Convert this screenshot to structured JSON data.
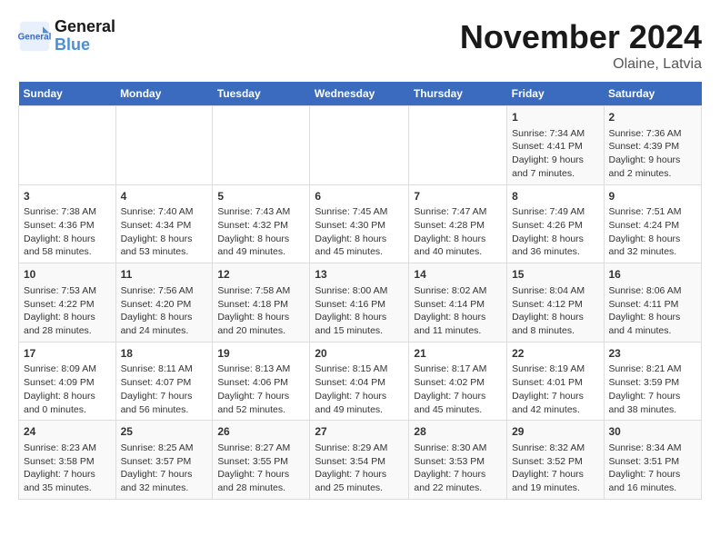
{
  "logo": {
    "line1": "General",
    "line2": "Blue"
  },
  "title": "November 2024",
  "location": "Olaine, Latvia",
  "headers": [
    "Sunday",
    "Monday",
    "Tuesday",
    "Wednesday",
    "Thursday",
    "Friday",
    "Saturday"
  ],
  "weeks": [
    [
      {
        "day": "",
        "sunrise": "",
        "sunset": "",
        "daylight": ""
      },
      {
        "day": "",
        "sunrise": "",
        "sunset": "",
        "daylight": ""
      },
      {
        "day": "",
        "sunrise": "",
        "sunset": "",
        "daylight": ""
      },
      {
        "day": "",
        "sunrise": "",
        "sunset": "",
        "daylight": ""
      },
      {
        "day": "",
        "sunrise": "",
        "sunset": "",
        "daylight": ""
      },
      {
        "day": "1",
        "sunrise": "Sunrise: 7:34 AM",
        "sunset": "Sunset: 4:41 PM",
        "daylight": "Daylight: 9 hours and 7 minutes."
      },
      {
        "day": "2",
        "sunrise": "Sunrise: 7:36 AM",
        "sunset": "Sunset: 4:39 PM",
        "daylight": "Daylight: 9 hours and 2 minutes."
      }
    ],
    [
      {
        "day": "3",
        "sunrise": "Sunrise: 7:38 AM",
        "sunset": "Sunset: 4:36 PM",
        "daylight": "Daylight: 8 hours and 58 minutes."
      },
      {
        "day": "4",
        "sunrise": "Sunrise: 7:40 AM",
        "sunset": "Sunset: 4:34 PM",
        "daylight": "Daylight: 8 hours and 53 minutes."
      },
      {
        "day": "5",
        "sunrise": "Sunrise: 7:43 AM",
        "sunset": "Sunset: 4:32 PM",
        "daylight": "Daylight: 8 hours and 49 minutes."
      },
      {
        "day": "6",
        "sunrise": "Sunrise: 7:45 AM",
        "sunset": "Sunset: 4:30 PM",
        "daylight": "Daylight: 8 hours and 45 minutes."
      },
      {
        "day": "7",
        "sunrise": "Sunrise: 7:47 AM",
        "sunset": "Sunset: 4:28 PM",
        "daylight": "Daylight: 8 hours and 40 minutes."
      },
      {
        "day": "8",
        "sunrise": "Sunrise: 7:49 AM",
        "sunset": "Sunset: 4:26 PM",
        "daylight": "Daylight: 8 hours and 36 minutes."
      },
      {
        "day": "9",
        "sunrise": "Sunrise: 7:51 AM",
        "sunset": "Sunset: 4:24 PM",
        "daylight": "Daylight: 8 hours and 32 minutes."
      }
    ],
    [
      {
        "day": "10",
        "sunrise": "Sunrise: 7:53 AM",
        "sunset": "Sunset: 4:22 PM",
        "daylight": "Daylight: 8 hours and 28 minutes."
      },
      {
        "day": "11",
        "sunrise": "Sunrise: 7:56 AM",
        "sunset": "Sunset: 4:20 PM",
        "daylight": "Daylight: 8 hours and 24 minutes."
      },
      {
        "day": "12",
        "sunrise": "Sunrise: 7:58 AM",
        "sunset": "Sunset: 4:18 PM",
        "daylight": "Daylight: 8 hours and 20 minutes."
      },
      {
        "day": "13",
        "sunrise": "Sunrise: 8:00 AM",
        "sunset": "Sunset: 4:16 PM",
        "daylight": "Daylight: 8 hours and 15 minutes."
      },
      {
        "day": "14",
        "sunrise": "Sunrise: 8:02 AM",
        "sunset": "Sunset: 4:14 PM",
        "daylight": "Daylight: 8 hours and 11 minutes."
      },
      {
        "day": "15",
        "sunrise": "Sunrise: 8:04 AM",
        "sunset": "Sunset: 4:12 PM",
        "daylight": "Daylight: 8 hours and 8 minutes."
      },
      {
        "day": "16",
        "sunrise": "Sunrise: 8:06 AM",
        "sunset": "Sunset: 4:11 PM",
        "daylight": "Daylight: 8 hours and 4 minutes."
      }
    ],
    [
      {
        "day": "17",
        "sunrise": "Sunrise: 8:09 AM",
        "sunset": "Sunset: 4:09 PM",
        "daylight": "Daylight: 8 hours and 0 minutes."
      },
      {
        "day": "18",
        "sunrise": "Sunrise: 8:11 AM",
        "sunset": "Sunset: 4:07 PM",
        "daylight": "Daylight: 7 hours and 56 minutes."
      },
      {
        "day": "19",
        "sunrise": "Sunrise: 8:13 AM",
        "sunset": "Sunset: 4:06 PM",
        "daylight": "Daylight: 7 hours and 52 minutes."
      },
      {
        "day": "20",
        "sunrise": "Sunrise: 8:15 AM",
        "sunset": "Sunset: 4:04 PM",
        "daylight": "Daylight: 7 hours and 49 minutes."
      },
      {
        "day": "21",
        "sunrise": "Sunrise: 8:17 AM",
        "sunset": "Sunset: 4:02 PM",
        "daylight": "Daylight: 7 hours and 45 minutes."
      },
      {
        "day": "22",
        "sunrise": "Sunrise: 8:19 AM",
        "sunset": "Sunset: 4:01 PM",
        "daylight": "Daylight: 7 hours and 42 minutes."
      },
      {
        "day": "23",
        "sunrise": "Sunrise: 8:21 AM",
        "sunset": "Sunset: 3:59 PM",
        "daylight": "Daylight: 7 hours and 38 minutes."
      }
    ],
    [
      {
        "day": "24",
        "sunrise": "Sunrise: 8:23 AM",
        "sunset": "Sunset: 3:58 PM",
        "daylight": "Daylight: 7 hours and 35 minutes."
      },
      {
        "day": "25",
        "sunrise": "Sunrise: 8:25 AM",
        "sunset": "Sunset: 3:57 PM",
        "daylight": "Daylight: 7 hours and 32 minutes."
      },
      {
        "day": "26",
        "sunrise": "Sunrise: 8:27 AM",
        "sunset": "Sunset: 3:55 PM",
        "daylight": "Daylight: 7 hours and 28 minutes."
      },
      {
        "day": "27",
        "sunrise": "Sunrise: 8:29 AM",
        "sunset": "Sunset: 3:54 PM",
        "daylight": "Daylight: 7 hours and 25 minutes."
      },
      {
        "day": "28",
        "sunrise": "Sunrise: 8:30 AM",
        "sunset": "Sunset: 3:53 PM",
        "daylight": "Daylight: 7 hours and 22 minutes."
      },
      {
        "day": "29",
        "sunrise": "Sunrise: 8:32 AM",
        "sunset": "Sunset: 3:52 PM",
        "daylight": "Daylight: 7 hours and 19 minutes."
      },
      {
        "day": "30",
        "sunrise": "Sunrise: 8:34 AM",
        "sunset": "Sunset: 3:51 PM",
        "daylight": "Daylight: 7 hours and 16 minutes."
      }
    ]
  ]
}
